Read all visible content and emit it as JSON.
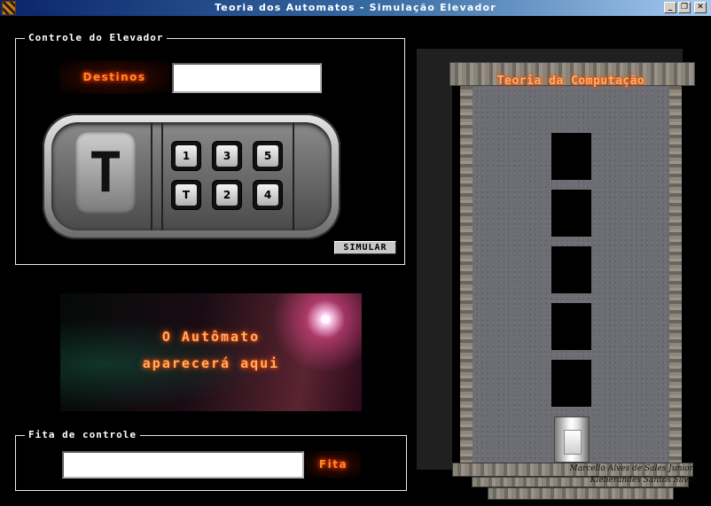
{
  "window": {
    "title": "Teoria dos Automatos - Simulação Elevador",
    "minimize_glyph": "_",
    "maximize_glyph": "❐",
    "close_glyph": "✕"
  },
  "controle": {
    "legend": "Controle do Elevador",
    "destinos_label": "Destinos",
    "destinos_value": "",
    "current_floor": "T",
    "keys_top": [
      "1",
      "3",
      "5"
    ],
    "keys_bottom": [
      "T",
      "2",
      "4"
    ],
    "simular_label": "SIMULAR"
  },
  "automato": {
    "line1": "O Autômato",
    "line2": "aparecerá aqui"
  },
  "fita": {
    "legend": "Fita de controle",
    "value": "",
    "label": "Fita"
  },
  "tower": {
    "title": "Teoria da Computação",
    "floors": 5,
    "cabin_floor": "T",
    "credits": [
      "Marcello Alves de Sales Junior",
      "Kleberandes Santos Silva"
    ]
  }
}
